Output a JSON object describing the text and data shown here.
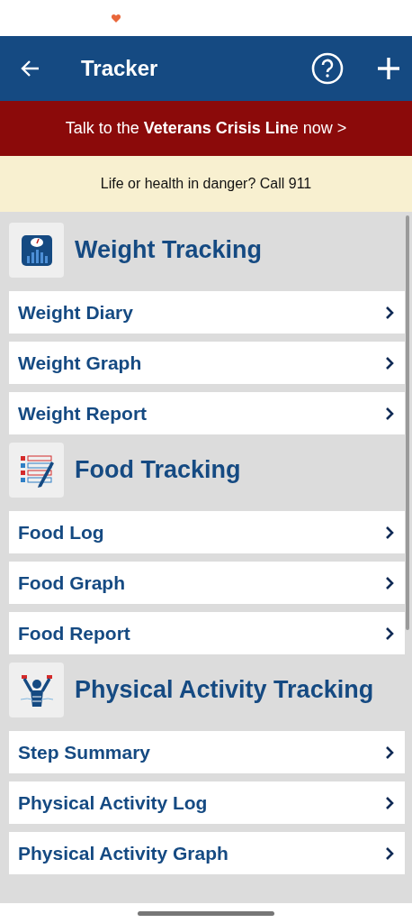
{
  "header": {
    "title": "Tracker"
  },
  "crisis_banner": {
    "text": "Talk to the **Veterans Crisis Lin**e now >"
  },
  "emergency_notice": {
    "text": "Life or health in danger? Call 911"
  },
  "sections": [
    {
      "kind": "weight",
      "title": "Weight Tracking",
      "items": [
        {
          "label": "Weight Diary"
        },
        {
          "label": "Weight Graph"
        },
        {
          "label": "Weight Report"
        }
      ]
    },
    {
      "kind": "food",
      "title": "Food Tracking",
      "items": [
        {
          "label": "Food Log"
        },
        {
          "label": "Food Graph"
        },
        {
          "label": "Food Report"
        }
      ]
    },
    {
      "kind": "activity",
      "title": "Physical Activity Tracking",
      "items": [
        {
          "label": "Step Summary"
        },
        {
          "label": "Physical Activity Log"
        },
        {
          "label": "Physical Activity Graph"
        }
      ]
    }
  ]
}
